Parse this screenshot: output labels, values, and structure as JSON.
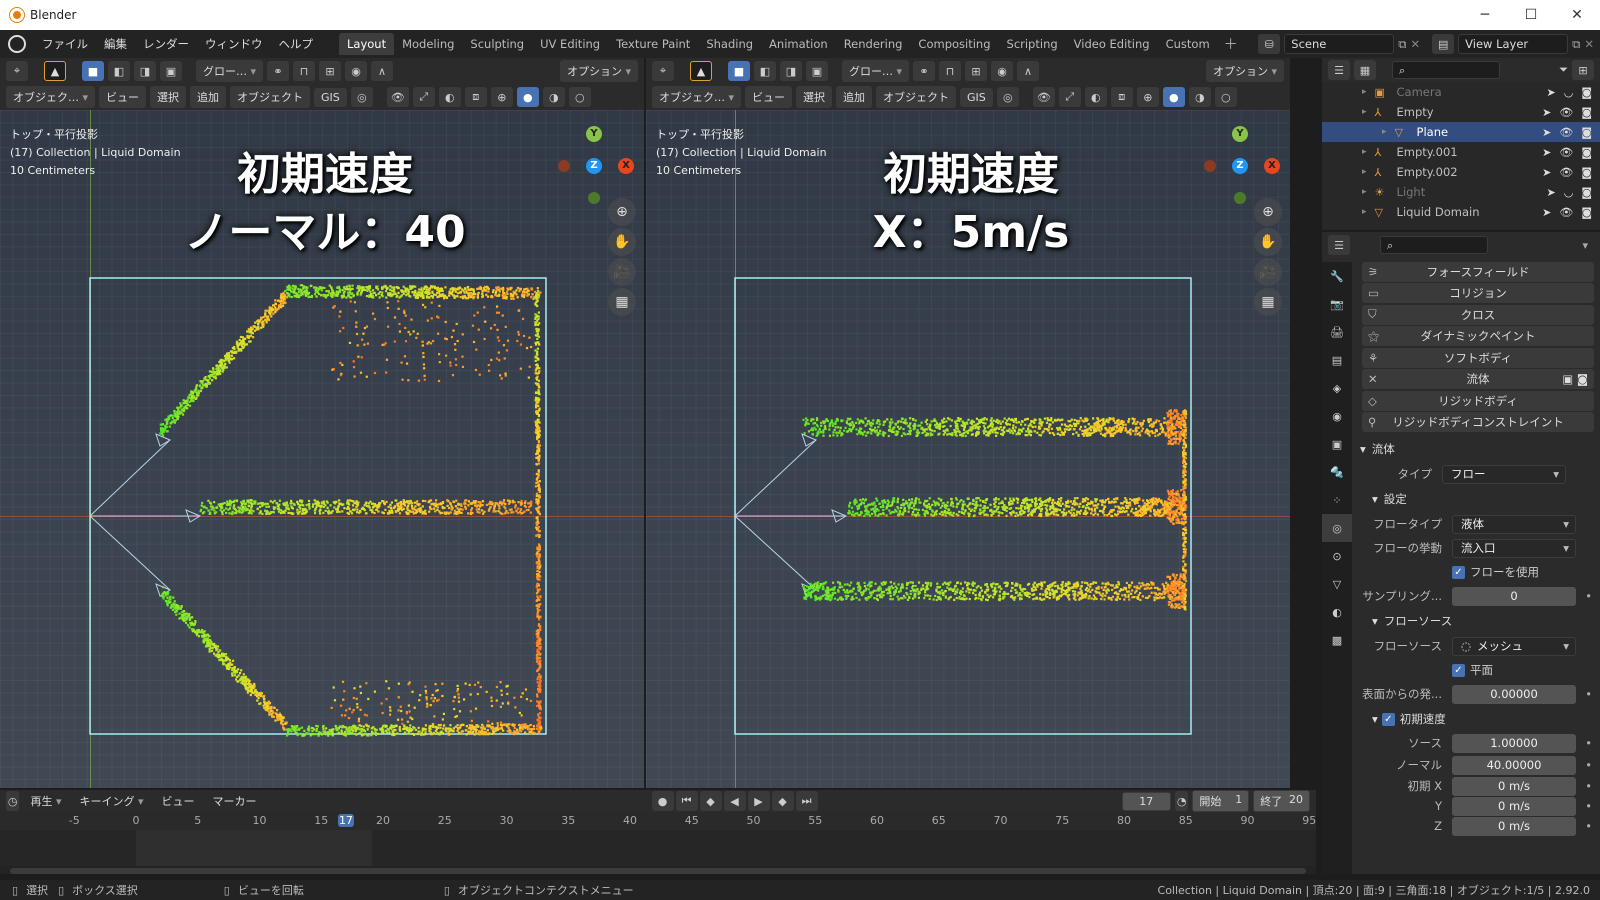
{
  "window": {
    "title": "Blender",
    "controls": [
      "─",
      "☐",
      "✕"
    ]
  },
  "menu": [
    "ファイル",
    "編集",
    "レンダー",
    "ウィンドウ",
    "ヘルプ"
  ],
  "workspaces": [
    "Layout",
    "Modeling",
    "Sculpting",
    "UV Editing",
    "Texture Paint",
    "Shading",
    "Animation",
    "Rendering",
    "Compositing",
    "Scripting",
    "Video Editing",
    "Custom"
  ],
  "active_workspace": "Layout",
  "scene": "Scene",
  "view_layer": "View Layer",
  "viewport_header": {
    "transform": "グロー…",
    "options": "オプション",
    "mode": "オブジェク…",
    "menus": [
      "ビュー",
      "選択",
      "追加",
      "オブジェクト",
      "GIS"
    ]
  },
  "viewports": [
    {
      "info": [
        "トップ・平行投影",
        "(17) Collection | Liquid Domain",
        "10 Centimeters"
      ],
      "overlay_line1": "初期速度",
      "overlay_line2": "ノーマル：40"
    },
    {
      "info": [
        "トップ・平行投影",
        "(17) Collection | Liquid Domain",
        "10 Centimeters"
      ],
      "overlay_line1": "初期速度",
      "overlay_line2": "X：5m/s"
    }
  ],
  "gizmo": {
    "y": "Y",
    "z": "Z",
    "x": "X"
  },
  "outliner": [
    {
      "name": "Camera",
      "icon": "camera-icon",
      "dim": true
    },
    {
      "name": "Empty",
      "icon": "empty-icon"
    },
    {
      "name": "Plane",
      "icon": "mesh-icon",
      "selected": true
    },
    {
      "name": "Empty.001",
      "icon": "empty-icon"
    },
    {
      "name": "Empty.002",
      "icon": "empty-icon"
    },
    {
      "name": "Light",
      "icon": "light-icon",
      "dim": true
    },
    {
      "name": "Liquid Domain",
      "icon": "mesh-icon"
    }
  ],
  "physics_buttons": [
    "フォースフィールド",
    "コリジョン",
    "クロス",
    "ダイナミックペイント",
    "ソフトボディ",
    "流体",
    "リジッドボディ",
    "リジッドボディコンストレイント"
  ],
  "fluid": {
    "section": "流体",
    "type_label": "タイプ",
    "type_value": "フロー",
    "settings": "設定",
    "flow_type_label": "フロータイプ",
    "flow_type_value": "液体",
    "flow_behavior_label": "フローの挙動",
    "flow_behavior_value": "流入口",
    "use_flow": "フローを使用",
    "sampling_label": "サンプリング...",
    "sampling_value": "0",
    "flow_source_section": "フローソース",
    "flow_source_label": "フローソース",
    "flow_source_value": "メッシュ",
    "plane": "平面",
    "surface_label": "表面からの発...",
    "surface_value": "0.00000",
    "init_velocity": "初期速度",
    "source_label": "ソース",
    "source_value": "1.00000",
    "normal_label": "ノーマル",
    "normal_value": "40.00000",
    "init_x_label": "初期 X",
    "init_x_value": "0 m/s",
    "y_label": "Y",
    "y_value": "0 m/s",
    "z_label": "Z",
    "z_value": "0 m/s"
  },
  "timeline": {
    "menus": [
      "再生",
      "キーイング",
      "ビュー",
      "マーカー"
    ],
    "current_frame": "17",
    "start_label": "開始",
    "start": "1",
    "end_label": "終了",
    "end": "20",
    "ticks": [
      "-5",
      "0",
      "5",
      "10",
      "15",
      "17",
      "20",
      "25",
      "30",
      "35",
      "40",
      "45",
      "50",
      "55",
      "60",
      "65",
      "70",
      "75",
      "80",
      "85",
      "90",
      "95"
    ]
  },
  "statusbar": {
    "select": "選択",
    "box_select": "ボックス選択",
    "rotate": "ビューを回転",
    "context": "オブジェクトコンテクストメニュー",
    "stats": "Collection | Liquid Domain | 頂点:20 | 面:9 | 三角面:18 | オブジェクト:1/5 | 2.92.0"
  }
}
